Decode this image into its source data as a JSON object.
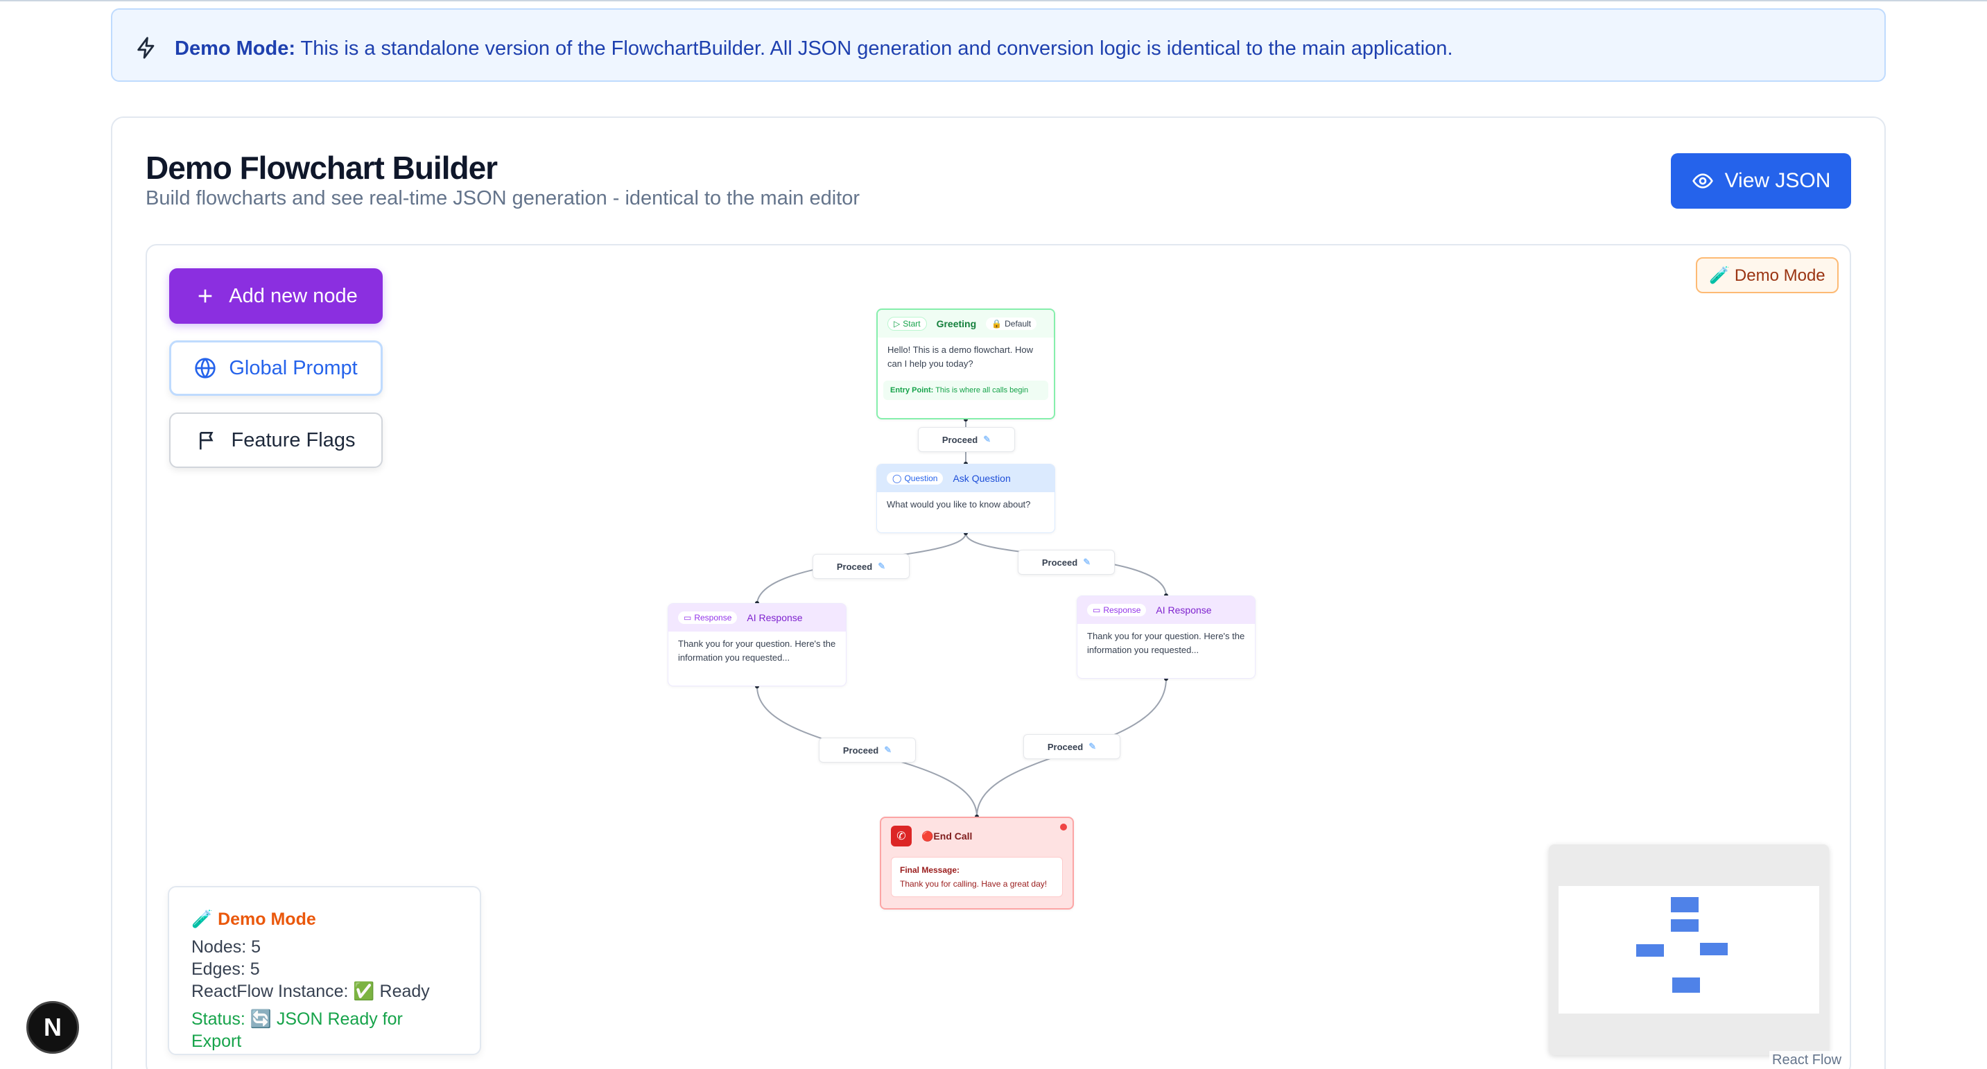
{
  "banner": {
    "label": "Demo Mode:",
    "text": " This is a standalone version of the FlowchartBuilder. All JSON generation and conversion logic is identical to the main application."
  },
  "header": {
    "title": "Demo Flowchart Builder",
    "subtitle": "Build flowcharts and see real-time JSON generation - identical to the main editor",
    "view_json_label": "View JSON"
  },
  "toolbar": {
    "add_node_label": "Add new node",
    "global_prompt_label": "Global Prompt",
    "feature_flags_label": "Feature Flags"
  },
  "demo_badge": "🧪 Demo Mode",
  "flow": {
    "start_node": {
      "tag_start": "Start",
      "title": "Greeting",
      "tag_default": "Default",
      "text": "Hello! This is a demo flowchart. How can I help you today?",
      "entry_label": "Entry Point:",
      "entry_text": "This is where all calls begin"
    },
    "question_node": {
      "tag": "Question",
      "title": "Ask Question",
      "text": "What would you like to know about?"
    },
    "response_node_1": {
      "tag": "Response",
      "title": "AI Response",
      "text": "Thank you for your question. Here's the information you requested..."
    },
    "response_node_2": {
      "tag": "Response",
      "title": "AI Response",
      "text": "Thank you for your question. Here's the information you requested..."
    },
    "end_node": {
      "title": "🔴End Call",
      "message_label": "Final Message:",
      "message_text": "Thank you for calling. Have a great day!"
    },
    "edge_label": "Proceed"
  },
  "stats": {
    "title": "🧪 Demo Mode",
    "nodes": "Nodes: 5",
    "edges": "Edges: 5",
    "instance": "ReactFlow Instance: ✅ Ready",
    "status": "Status: 🔄 JSON Ready for Export"
  },
  "attribution": "React Flow",
  "next_badge": "N",
  "colors": {
    "primary": "#2563eb",
    "add_node": "#8b2fe0",
    "start_border": "#86efac",
    "end_bg": "#fee2e2"
  }
}
